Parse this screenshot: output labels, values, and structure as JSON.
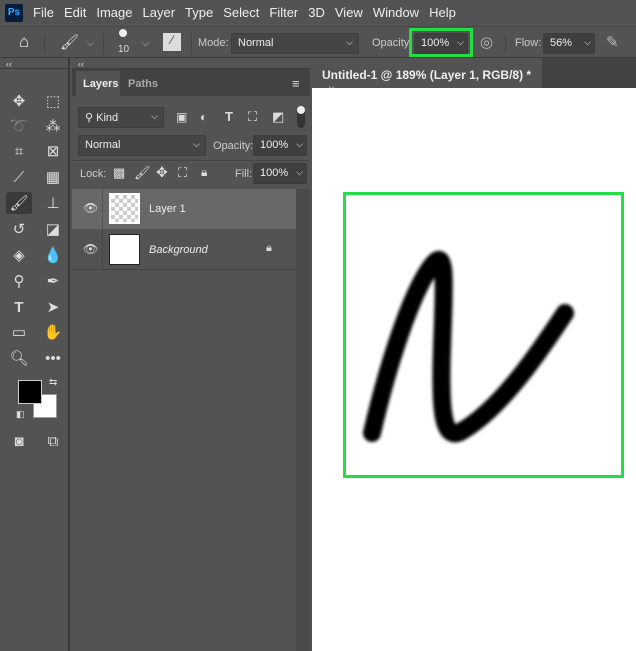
{
  "menubar": {
    "logo": "Ps",
    "items": [
      "File",
      "Edit",
      "Image",
      "Layer",
      "Type",
      "Select",
      "Filter",
      "3D",
      "View",
      "Window",
      "Help"
    ]
  },
  "options": {
    "brush_size": "10",
    "mode_label": "Mode:",
    "mode_value": "Normal",
    "opacity_label": "Opacity:",
    "opacity_value": "100%",
    "flow_label": "Flow:",
    "flow_value": "56%"
  },
  "panel": {
    "tabs": [
      "Layers",
      "Paths"
    ],
    "filter": "Kind",
    "blend_mode": "Normal",
    "opacity_label": "Opacity:",
    "opacity_value": "100%",
    "lock_label": "Lock:",
    "fill_label": "Fill:",
    "fill_value": "100%",
    "layers": [
      {
        "name": "Layer 1"
      },
      {
        "name": "Background"
      }
    ]
  },
  "document": {
    "tab_title": "Untitled-1 @ 189% (Layer 1, RGB/8) *",
    "close": "×"
  },
  "colors": {
    "highlight": "#22dd44",
    "foreground": "#000000",
    "background": "#ffffff"
  }
}
